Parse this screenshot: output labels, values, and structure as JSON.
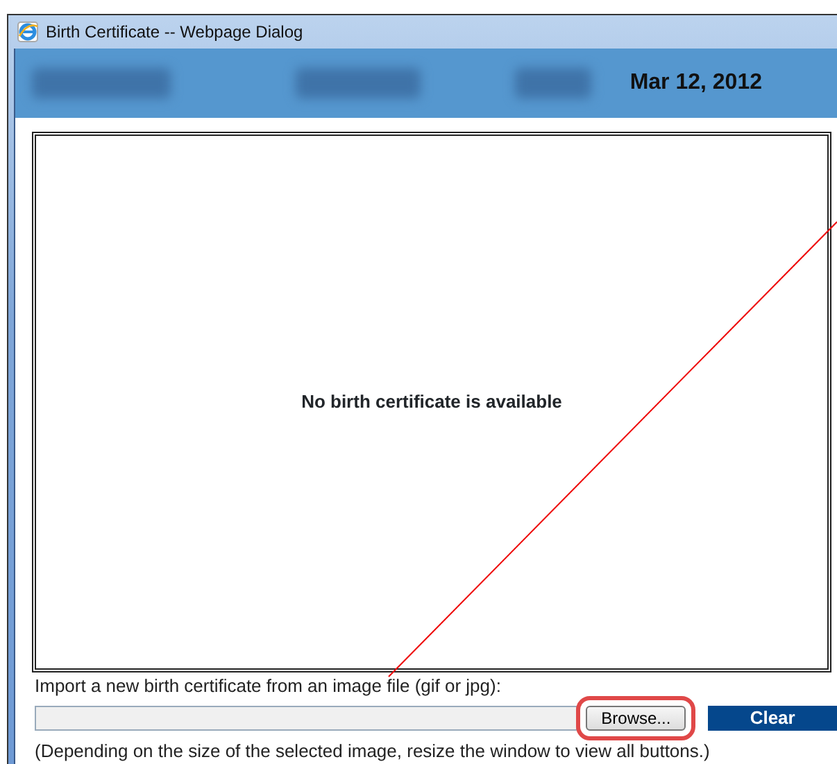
{
  "window": {
    "title": "Birth Certificate -- Webpage Dialog"
  },
  "header": {
    "date": "Mar 12, 2012"
  },
  "viewer": {
    "message": "No birth certificate is available"
  },
  "import": {
    "label": "Import a new birth certificate from an image file (gif or jpg):",
    "browse_button": "Browse...",
    "clear_button": "Clear",
    "note": "(Depending on the size of the selected image, resize the window to view all buttons.)"
  },
  "annotation": {
    "highlight_browse": true
  }
}
